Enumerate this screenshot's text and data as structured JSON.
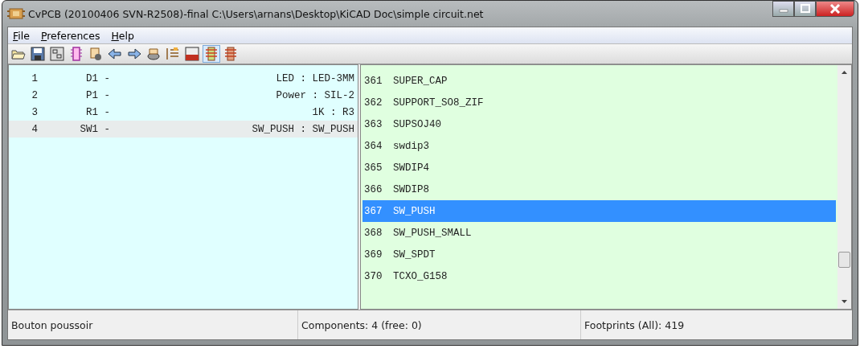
{
  "window": {
    "title": "CvPCB (20100406 SVN-R2508)-final C:\\Users\\arnans\\Desktop\\KiCAD Doc\\simple circuit.net"
  },
  "menu": [
    {
      "label": "File"
    },
    {
      "label": "Preferences"
    },
    {
      "label": "Help"
    }
  ],
  "toolbar": [
    {
      "kind": "open",
      "selected": false
    },
    {
      "kind": "save",
      "selected": false
    },
    {
      "kind": "module",
      "selected": false
    },
    {
      "kind": "chip",
      "selected": false
    },
    {
      "kind": "library",
      "selected": false
    },
    {
      "kind": "prev",
      "selected": false
    },
    {
      "kind": "next",
      "selected": false
    },
    {
      "kind": "display",
      "selected": false
    },
    {
      "kind": "list",
      "selected": false
    },
    {
      "kind": "pdf",
      "selected": false
    },
    {
      "kind": "filter",
      "selected": true
    },
    {
      "kind": "all",
      "selected": false
    }
  ],
  "components": [
    {
      "index": "1",
      "reference": "D1 -",
      "assignment": "LED : LED-3MM",
      "selected": false
    },
    {
      "index": "2",
      "reference": "P1 -",
      "assignment": "Power : SIL-2",
      "selected": false
    },
    {
      "index": "3",
      "reference": "R1 -",
      "assignment": "1K : R3",
      "selected": false
    },
    {
      "index": "4",
      "reference": "SW1 -",
      "assignment": "SW_PUSH : SW_PUSH",
      "selected": true
    }
  ],
  "footprints": [
    {
      "index": "361",
      "name": "SUPER_CAP",
      "selected": false
    },
    {
      "index": "362",
      "name": "SUPPORT_SO8_ZIF",
      "selected": false
    },
    {
      "index": "363",
      "name": "SUPSOJ40",
      "selected": false
    },
    {
      "index": "364",
      "name": "swdip3",
      "selected": false
    },
    {
      "index": "365",
      "name": "SWDIP4",
      "selected": false
    },
    {
      "index": "366",
      "name": "SWDIP8",
      "selected": false
    },
    {
      "index": "367",
      "name": "SW_PUSH",
      "selected": true
    },
    {
      "index": "368",
      "name": "SW_PUSH_SMALL",
      "selected": false
    },
    {
      "index": "369",
      "name": "SW_SPDT",
      "selected": false
    },
    {
      "index": "370",
      "name": "TCXO_G158",
      "selected": false
    }
  ],
  "status_bar": [
    "Bouton poussoir",
    "Components: 4 (free: 0)",
    "Footprints (All): 419"
  ]
}
